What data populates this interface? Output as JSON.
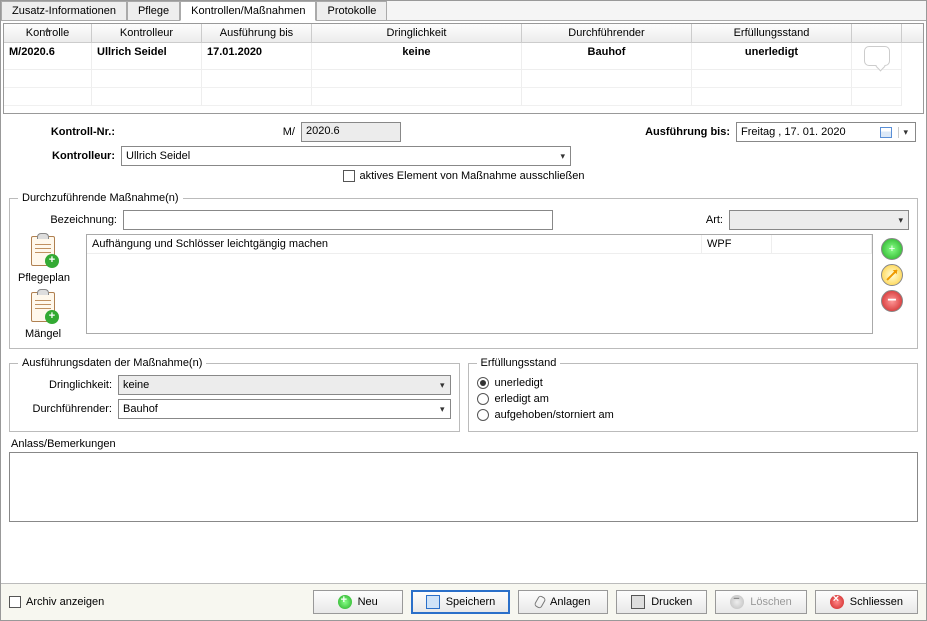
{
  "tabs": [
    "Zusatz-Informationen",
    "Pflege",
    "Kontrollen/Maßnahmen",
    "Protokolle"
  ],
  "activeTab": 2,
  "grid": {
    "headers": [
      "Kontrolle",
      "Kontrolleur",
      "Ausführung bis",
      "Dringlichkeit",
      "Durchführender",
      "Erfüllungsstand"
    ],
    "row": {
      "kontrolle": "M/2020.6",
      "kontrolleur": "Ullrich Seidel",
      "ausfuehrung": "17.01.2020",
      "dringlichkeit": "keine",
      "durchfuehrender": "Bauhof",
      "erfuellung": "unerledigt"
    }
  },
  "kontrollnr_label": "Kontroll-Nr.:",
  "kontrollnr_prefix": "M/",
  "kontrollnr_value": "2020.6",
  "kontrolleur_label": "Kontrolleur:",
  "kontrolleur_value": "Ullrich Seidel",
  "ausfuehrung_label": "Ausführung bis:",
  "ausfuehrung_value": "Freitag   , 17. 01. 2020",
  "exclude_label": "aktives Element von Maßnahme ausschließen",
  "massnahmen_legend": "Durchzuführende Maßnahme(n)",
  "bezeichnung_label": "Bezeichnung:",
  "art_label": "Art:",
  "pflegeplan_label": "Pflegeplan",
  "maengel_label": "Mängel",
  "mn_row": {
    "text": "Aufhängung und Schlösser leichtgängig machen",
    "art": "WPF"
  },
  "ausfuehrungs_legend": "Ausführungsdaten der Maßnahme(n)",
  "dringlichkeit_label": "Dringlichkeit:",
  "dringlichkeit_value": "keine",
  "durchfuehrender_label": "Durchführender:",
  "durchfuehrender_value": "Bauhof",
  "erfuellung_legend": "Erfüllungsstand",
  "erfuellung_options": [
    "unerledigt",
    "erledigt am",
    "aufgehoben/storniert am"
  ],
  "anlass_label": "Anlass/Bemerkungen",
  "archiv_label": "Archiv anzeigen",
  "buttons": {
    "neu": "Neu",
    "speichern": "Speichern",
    "anlagen": "Anlagen",
    "drucken": "Drucken",
    "loeschen": "Löschen",
    "schliessen": "Schliessen"
  }
}
